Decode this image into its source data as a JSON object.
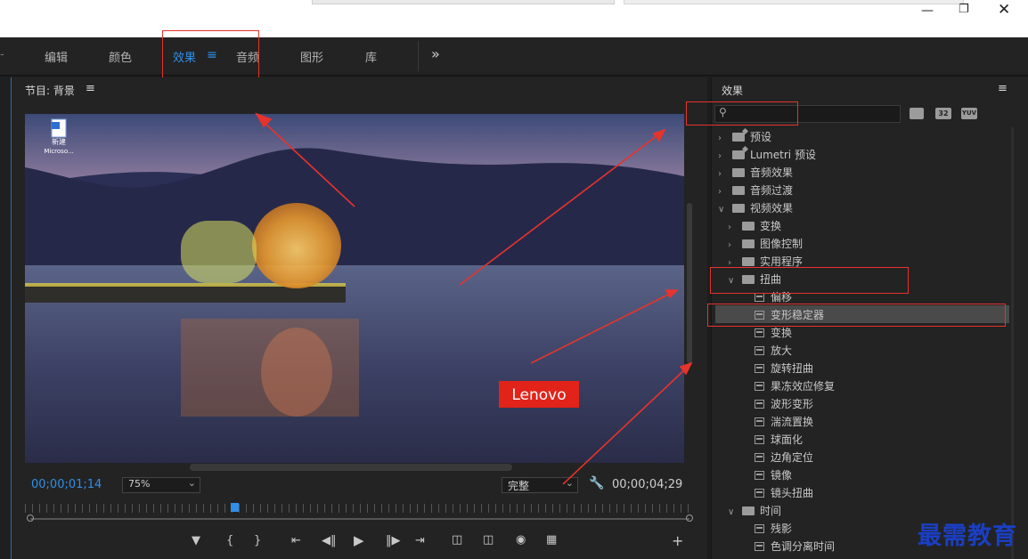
{
  "workspace_tabs": [
    {
      "label": "编辑",
      "active": false
    },
    {
      "label": "颜色",
      "active": false
    },
    {
      "label": "效果",
      "active": true
    },
    {
      "label": "音频",
      "active": false
    },
    {
      "label": "图形",
      "active": false
    },
    {
      "label": "库",
      "active": false
    }
  ],
  "overflow_label": "»",
  "program": {
    "title": "节目: 背景",
    "current_time": "00;00;01;14",
    "zoom": "75%",
    "quality": "完整",
    "duration": "00;00;04;29",
    "desktop_icon_label1": "新建",
    "desktop_icon_label2": "Microso...",
    "brand_logo": "Lenovo",
    "playhead_fraction": 0.31
  },
  "effects": {
    "title": "效果",
    "search": {
      "value": "",
      "placeholder": ""
    },
    "filter_badges": [
      "32",
      "YUV"
    ],
    "tree": [
      {
        "label": "预设",
        "level": 0,
        "type": "folder-star",
        "open": false
      },
      {
        "label": "Lumetri 预设",
        "level": 0,
        "type": "folder-star",
        "open": false
      },
      {
        "label": "音频效果",
        "level": 0,
        "type": "folder",
        "open": false
      },
      {
        "label": "音频过渡",
        "level": 0,
        "type": "folder",
        "open": false
      },
      {
        "label": "视频效果",
        "level": 0,
        "type": "folder",
        "open": true
      },
      {
        "label": "变换",
        "level": 1,
        "type": "folder",
        "open": false
      },
      {
        "label": "图像控制",
        "level": 1,
        "type": "folder",
        "open": false
      },
      {
        "label": "实用程序",
        "level": 1,
        "type": "folder",
        "open": false
      },
      {
        "label": "扭曲",
        "level": 1,
        "type": "folder",
        "open": true
      },
      {
        "label": "偏移",
        "level": 2,
        "type": "effect"
      },
      {
        "label": "变形稳定器",
        "level": 2,
        "type": "effect",
        "selected": true
      },
      {
        "label": "变换",
        "level": 2,
        "type": "effect"
      },
      {
        "label": "放大",
        "level": 2,
        "type": "effect"
      },
      {
        "label": "旋转扭曲",
        "level": 2,
        "type": "effect"
      },
      {
        "label": "果冻效应修复",
        "level": 2,
        "type": "effect"
      },
      {
        "label": "波形变形",
        "level": 2,
        "type": "effect"
      },
      {
        "label": "湍流置换",
        "level": 2,
        "type": "effect"
      },
      {
        "label": "球面化",
        "level": 2,
        "type": "effect"
      },
      {
        "label": "边角定位",
        "level": 2,
        "type": "effect"
      },
      {
        "label": "镜像",
        "level": 2,
        "type": "effect"
      },
      {
        "label": "镜头扭曲",
        "level": 2,
        "type": "effect"
      },
      {
        "label": "时间",
        "level": 1,
        "type": "folder",
        "open": true
      },
      {
        "label": "残影",
        "level": 2,
        "type": "effect"
      },
      {
        "label": "色调分离时间",
        "level": 2,
        "type": "effect"
      }
    ]
  },
  "watermark": "最需教育",
  "colors": {
    "accent": "#2f8fe8",
    "annotation": "#e8332c",
    "watermark": "#1a3fc4"
  }
}
